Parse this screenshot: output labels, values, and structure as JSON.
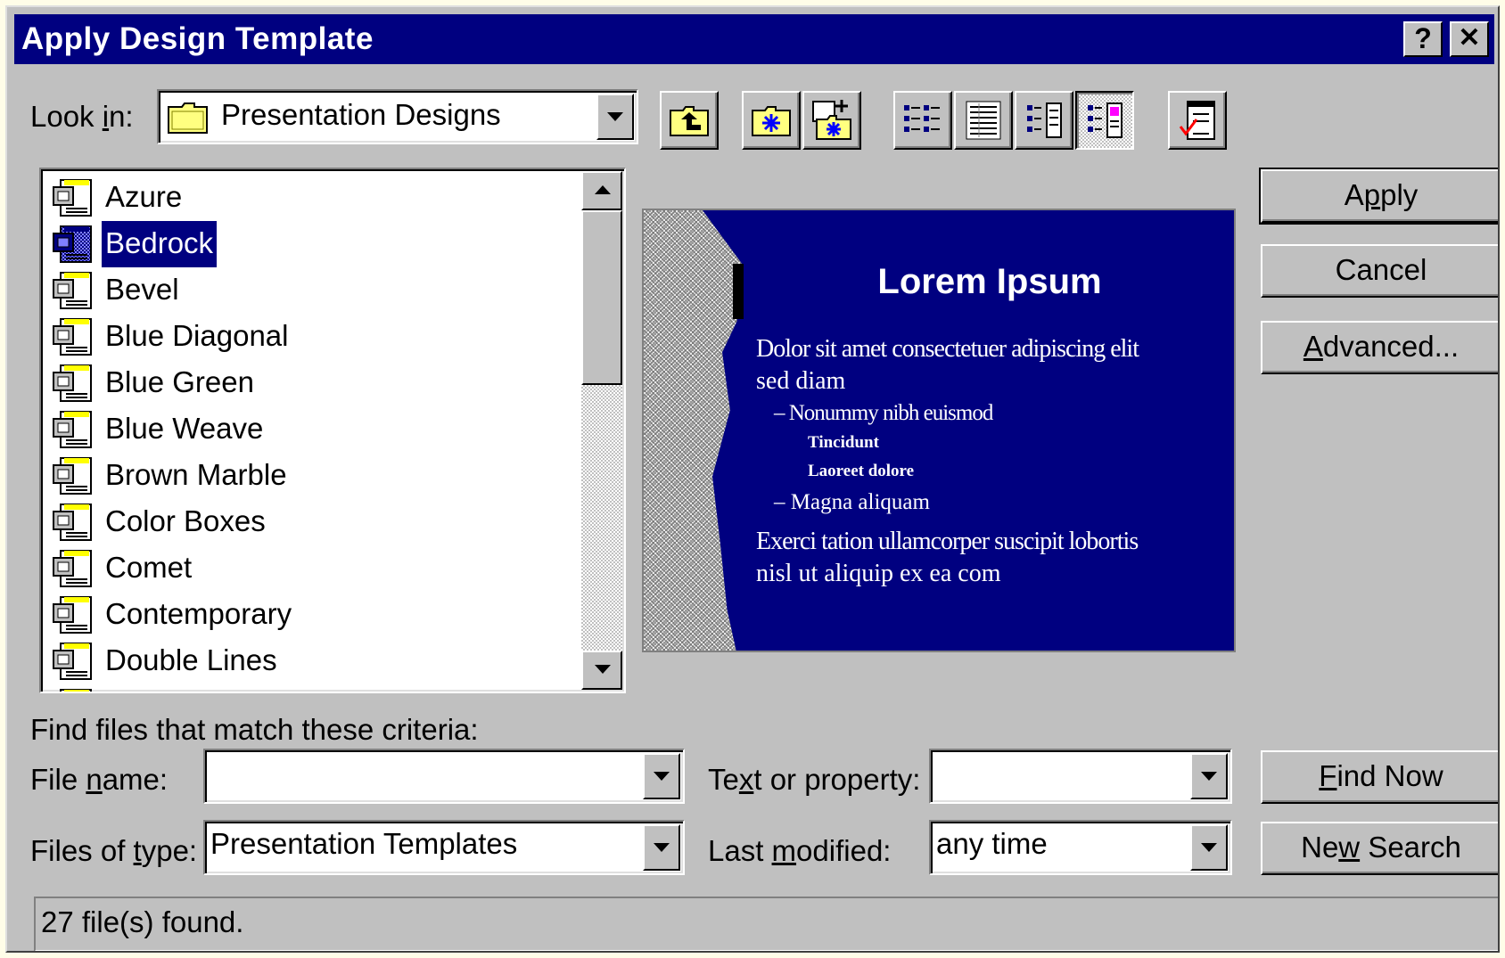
{
  "window": {
    "title": "Apply Design Template",
    "help_label": "?",
    "close_label": "✕"
  },
  "lookin": {
    "label_pre": "Look ",
    "label_u": "i",
    "label_post": "n:",
    "value": "Presentation Designs"
  },
  "toolbar": {
    "icons": [
      "up-one-level-icon",
      "look-in-favorites-icon",
      "add-to-favorites-icon",
      "list-view-icon",
      "details-view-icon",
      "properties-view-icon",
      "preview-view-icon",
      "commands-and-settings-icon"
    ]
  },
  "files": {
    "items": [
      "Azure",
      "Bedrock",
      "Bevel",
      "Blue Diagonal",
      "Blue Green",
      "Blue Weave",
      "Brown Marble",
      "Color Boxes",
      "Comet",
      "Contemporary",
      "Double Lines"
    ],
    "selected_index": 1
  },
  "preview": {
    "title": "Lorem Ipsum",
    "line1": "Dolor sit amet consectetuer adipiscing elit",
    "line2": "sed diam",
    "line3": "– Nonummy nibh euismod",
    "line4": "Tincidunt",
    "line5": "Laoreet dolore",
    "line6": "– Magna aliquam",
    "line7": "Exerci tation ullamcorper suscipit lobortis",
    "line8": "nisl ut aliquip ex ea com"
  },
  "buttons": {
    "apply_pre": "A",
    "apply_u": "p",
    "apply_post": "ply",
    "cancel": "Cancel",
    "advanced_u": "A",
    "advanced_post": "dvanced...",
    "find_now_u": "F",
    "find_now_post": "ind Now",
    "new_search_pre": "Ne",
    "new_search_u": "w",
    "new_search_post": " Search"
  },
  "criteria": {
    "heading": "Find files that match these criteria:",
    "file_name_pre": "File ",
    "file_name_u": "n",
    "file_name_post": "ame:",
    "file_name_value": "",
    "files_of_type_pre": "Files of ",
    "files_of_type_u": "t",
    "files_of_type_post": "ype:",
    "files_of_type_value": "Presentation Templates",
    "text_prop_pre": "Te",
    "text_prop_u": "x",
    "text_prop_post": "t or property:",
    "text_prop_value": "",
    "last_mod_pre": "Last ",
    "last_mod_u": "m",
    "last_mod_post": "odified:",
    "last_mod_value": "any time"
  },
  "status": {
    "text": "27 file(s) found."
  },
  "colors": {
    "face": "#c0c0c0",
    "titlebar": "#000080",
    "selection": "#000080",
    "preview_bg": "#000080"
  }
}
